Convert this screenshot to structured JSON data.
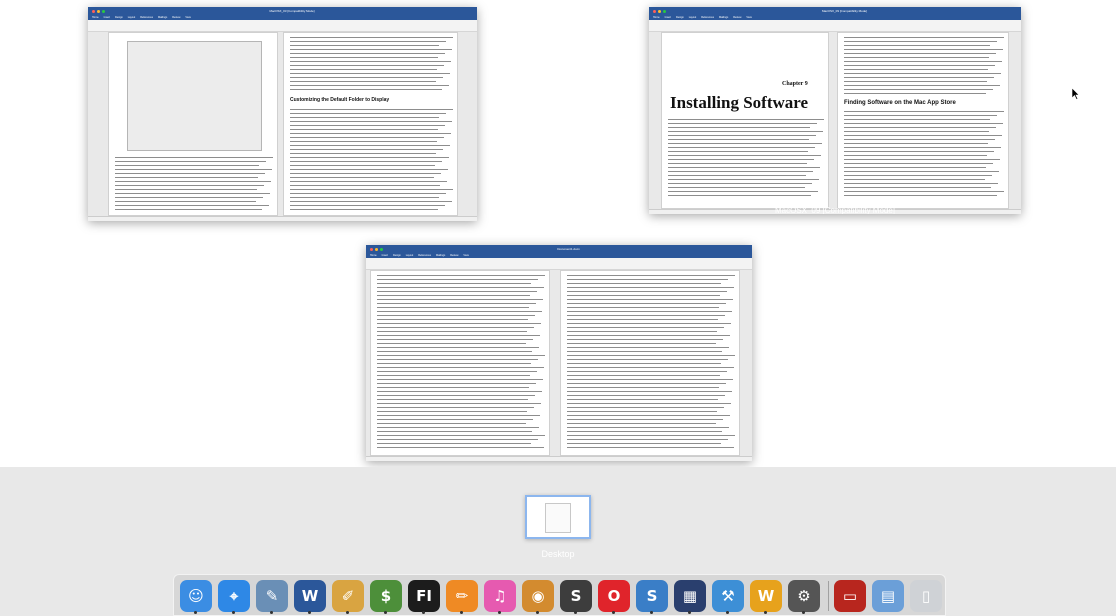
{
  "windows": [
    {
      "title": "MacOSX_03 [Compatibility Mode]",
      "tabs": [
        "Home",
        "Insert",
        "Design",
        "Layout",
        "References",
        "Mailings",
        "Review",
        "View"
      ],
      "heading": "Customizing the Default Folder to Display",
      "label": ""
    },
    {
      "title": "MacOSX_09 [Compatibility Mode]",
      "tabs": [
        "Home",
        "Insert",
        "Design",
        "Layout",
        "References",
        "Mailings",
        "Review",
        "View"
      ],
      "chapter": "Chapter 9",
      "heading": "Installing Software",
      "subheading": "Finding Software on the Mac App Store",
      "label": "MacOSX_09 [Compatibility Mode]"
    },
    {
      "title": "Document1.docx",
      "tabs": [
        "Home",
        "Insert",
        "Design",
        "Layout",
        "References",
        "Mailings",
        "Review",
        "View"
      ],
      "label": ""
    }
  ],
  "desktop": {
    "label": "Desktop"
  },
  "dock": {
    "items": [
      {
        "name": "finder-icon",
        "glyph": "☺",
        "color": "#3b8de3"
      },
      {
        "name": "safari-icon",
        "glyph": "⌖",
        "color": "#2e88e6"
      },
      {
        "name": "preview-icon",
        "glyph": "✎",
        "color": "#6a8fb6"
      },
      {
        "name": "word-icon",
        "glyph": "W",
        "color": "#2b579a"
      },
      {
        "name": "notes-icon",
        "glyph": "✐",
        "color": "#d9a441"
      },
      {
        "name": "money-icon",
        "glyph": "$",
        "color": "#4d8f3a"
      },
      {
        "name": "fi-icon",
        "glyph": "FI",
        "color": "#1c1c1c"
      },
      {
        "name": "pages-icon",
        "glyph": "✏",
        "color": "#ef8a24"
      },
      {
        "name": "itunes-icon",
        "glyph": "♫",
        "color": "#e65ab0"
      },
      {
        "name": "game-icon",
        "glyph": "◉",
        "color": "#d38b2f"
      },
      {
        "name": "skype-icon",
        "glyph": "S",
        "color": "#3d3d3d"
      },
      {
        "name": "opera-icon",
        "glyph": "O",
        "color": "#e0242b"
      },
      {
        "name": "scrivener-icon",
        "glyph": "S",
        "color": "#3a7ec7"
      },
      {
        "name": "calculator-icon",
        "glyph": "▦",
        "color": "#2a3f6e"
      },
      {
        "name": "xcode-icon",
        "glyph": "⚒",
        "color": "#3d8fd6"
      },
      {
        "name": "wordpress-icon",
        "glyph": "W",
        "color": "#e7a21c"
      },
      {
        "name": "system-preferences-icon",
        "glyph": "⚙",
        "color": "#555555"
      },
      {
        "name": "flashcard-icon",
        "glyph": "▭",
        "color": "#b8261e"
      },
      {
        "name": "downloads-icon",
        "glyph": "▤",
        "color": "#6b9fd8"
      },
      {
        "name": "trash-icon",
        "glyph": "▯",
        "color": "#cfd2d6"
      }
    ]
  }
}
